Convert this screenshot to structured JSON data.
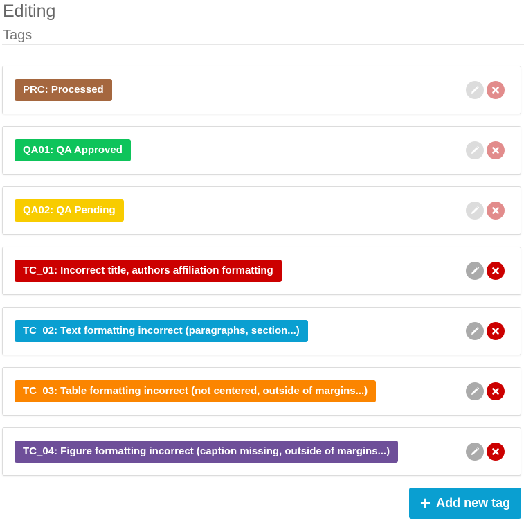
{
  "header": {
    "title": "Editing",
    "section": "Tags"
  },
  "tags": [
    {
      "label": "PRC: Processed",
      "color": "#a5673f",
      "locked": true
    },
    {
      "label": "QA01: QA Approved",
      "color": "#0ec45b",
      "locked": true
    },
    {
      "label": "QA02: QA Pending",
      "color": "#f8cc00",
      "locked": true
    },
    {
      "label": "TC_01: Incorrect title, authors affiliation formatting",
      "color": "#cc0000",
      "locked": false
    },
    {
      "label": "TC_02: Text formatting incorrect (paragraphs, section...)",
      "color": "#0a9fd1",
      "locked": false
    },
    {
      "label": "TC_03: Table formatting incorrect (not centered, outside of margins...)",
      "color": "#fb8500",
      "locked": false
    },
    {
      "label": "TC_04: Figure formatting incorrect (caption missing, outside of margins...)",
      "color": "#6e4f99",
      "locked": false
    }
  ],
  "icons": {
    "edit": "pencil-icon",
    "delete": "close-icon",
    "add": "plus-icon"
  },
  "footer": {
    "add_label": "Add new tag"
  }
}
